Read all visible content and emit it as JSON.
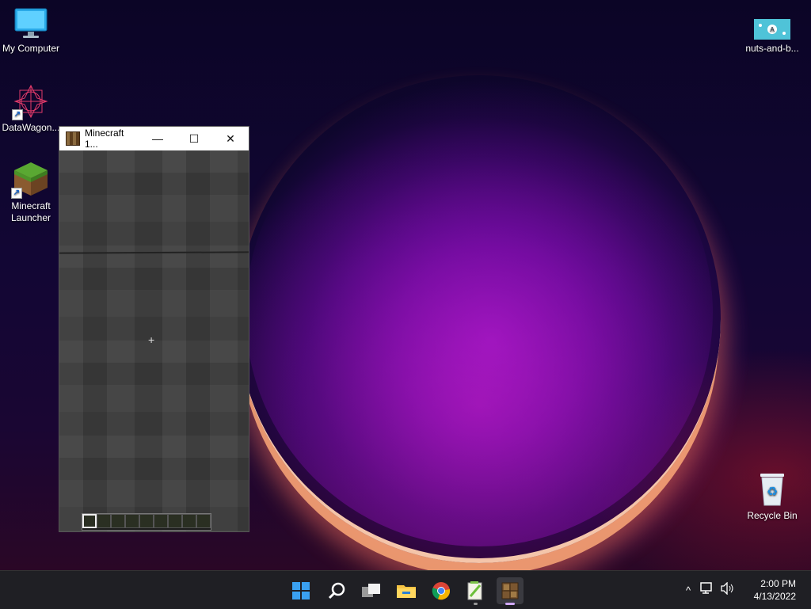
{
  "desktop": {
    "icons": [
      {
        "label": "My Computer"
      },
      {
        "label": "DataWagon..."
      },
      {
        "label": "Minecraft Launcher"
      },
      {
        "label": "nuts-and-b..."
      },
      {
        "label": "Recycle Bin"
      }
    ]
  },
  "minecraft_window": {
    "title": "Minecraft 1...",
    "minimize_glyph": "—",
    "maximize_glyph": "☐",
    "close_glyph": "✕",
    "crosshair": "+",
    "hotbar_slots": 9,
    "selected_slot": 1
  },
  "taskbar": {
    "apps": [
      "start-icon",
      "search-icon",
      "task-view-icon",
      "file-explorer-icon",
      "chrome-icon",
      "notepad-plus-icon",
      "minecraft-icon"
    ],
    "tray_chevron": "^",
    "clock_time": "2:00 PM",
    "clock_date": "4/13/2022"
  },
  "colors": {
    "accent": "#d0a8ff",
    "taskbar": "#1f1f24"
  }
}
